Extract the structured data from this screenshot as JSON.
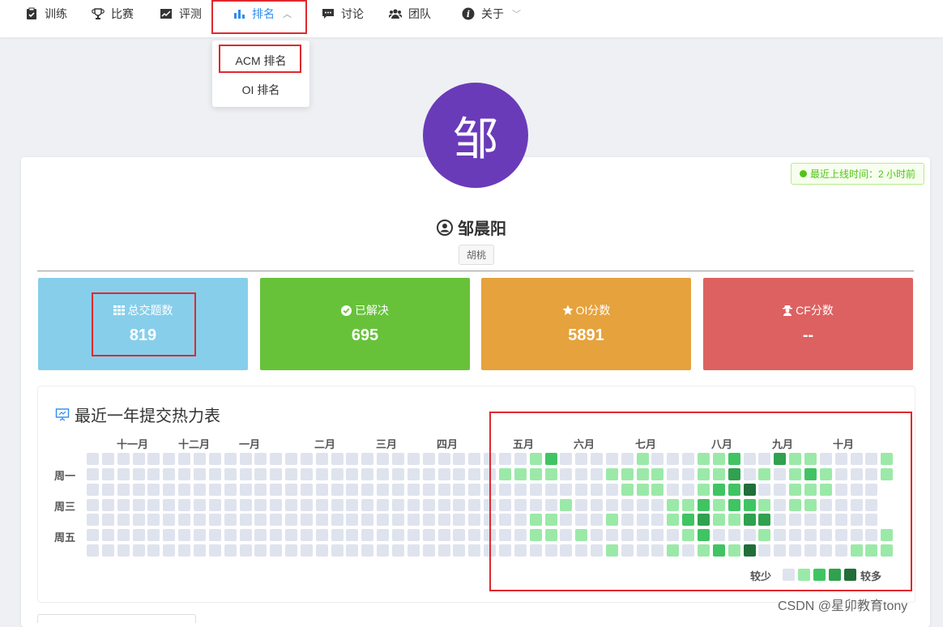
{
  "nav": {
    "items": [
      {
        "label": "训练",
        "icon": "clipboard-icon"
      },
      {
        "label": "比赛",
        "icon": "trophy-icon"
      },
      {
        "label": "评测",
        "icon": "chart-line-icon"
      },
      {
        "label": "排名",
        "icon": "bar-chart-icon",
        "active": true
      },
      {
        "label": "讨论",
        "icon": "comment-icon"
      },
      {
        "label": "团队",
        "icon": "users-icon"
      },
      {
        "label": "关于",
        "icon": "info-icon"
      }
    ],
    "dropdown": [
      "ACM 排名",
      "OI 排名"
    ]
  },
  "profile": {
    "avatar_char": "邹",
    "username": "邹晨阳",
    "tag": "胡桃",
    "online_status": "最近上线时间：2 小时前"
  },
  "stats": [
    {
      "label": "总交题数",
      "value": "819",
      "color": "#87ceeb",
      "icon": "grid-icon"
    },
    {
      "label": "已解决",
      "value": "695",
      "color": "#67c23a",
      "icon": "check-circle-icon"
    },
    {
      "label": "OI分数",
      "value": "5891",
      "color": "#e6a23c",
      "icon": "star-icon"
    },
    {
      "label": "CF分数",
      "value": "--",
      "color": "#dd6161",
      "icon": "user-secret-icon"
    }
  ],
  "heatmap": {
    "title": "最近一年提交热力表",
    "months": [
      "十一月",
      "十二月",
      "一月",
      "二月",
      "三月",
      "四月",
      "五月",
      "六月",
      "七月",
      "八月",
      "九月",
      "十月"
    ],
    "weekdays": [
      "周一",
      "周三",
      "周五"
    ],
    "legend_less": "较少",
    "legend_more": "较多",
    "colors": [
      "#dfe3ee",
      "#9be9a8",
      "#40c463",
      "#30a14e",
      "#216e39"
    ]
  },
  "watermark": "CSDN @星卯教育tony"
}
